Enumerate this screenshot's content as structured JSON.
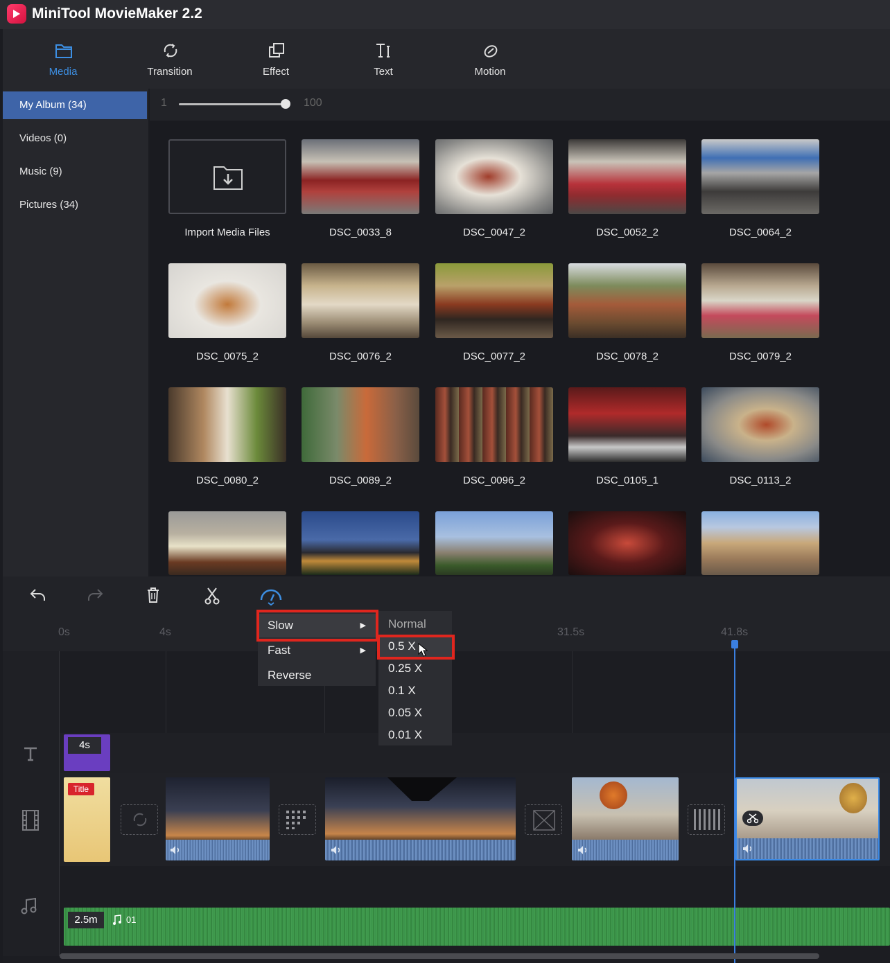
{
  "app": {
    "title": "MiniTool MovieMaker 2.2"
  },
  "toolbar": [
    {
      "label": "Media",
      "icon": "folder-icon",
      "active": true
    },
    {
      "label": "Transition",
      "icon": "transition-icon"
    },
    {
      "label": "Effect",
      "icon": "effect-icon"
    },
    {
      "label": "Text",
      "icon": "text-icon"
    },
    {
      "label": "Motion",
      "icon": "motion-icon"
    }
  ],
  "albums": [
    {
      "label": "My Album",
      "count": "(34)"
    },
    {
      "label": "Videos",
      "count": "(0)"
    },
    {
      "label": "Music",
      "count": "(9)"
    },
    {
      "label": "Pictures",
      "count": "(34)"
    }
  ],
  "zoom": {
    "min": "1",
    "max": "100",
    "value": 100
  },
  "media": [
    {
      "name": "Import Media Files"
    },
    {
      "name": "DSC_0033_8"
    },
    {
      "name": "DSC_0047_2"
    },
    {
      "name": "DSC_0052_2"
    },
    {
      "name": "DSC_0064_2"
    },
    {
      "name": "DSC_0075_2"
    },
    {
      "name": "DSC_0076_2"
    },
    {
      "name": "DSC_0077_2"
    },
    {
      "name": "DSC_0078_2"
    },
    {
      "name": "DSC_0079_2"
    },
    {
      "name": "DSC_0080_2"
    },
    {
      "name": "DSC_0089_2"
    },
    {
      "name": "DSC_0096_2"
    },
    {
      "name": "DSC_0105_1"
    },
    {
      "name": "DSC_0113_2"
    }
  ],
  "timeline": {
    "ticks": [
      "0s",
      "4s",
      "31.5s",
      "41.8s"
    ],
    "title_clip": {
      "duration": "4s",
      "badge": "Title"
    },
    "music_clip": {
      "duration": "2.5m",
      "name": "01"
    }
  },
  "speed_menu": {
    "items": [
      "Slow",
      "Fast",
      "Reverse"
    ],
    "submenu": [
      "Normal",
      "0.5 X",
      "0.25 X",
      "0.1 X",
      "0.05 X",
      "0.01 X"
    ],
    "highlighted": "Slow",
    "selected": "0.5 X"
  },
  "colors": {
    "accent": "#3d8fe3",
    "highlight": "#e0261e",
    "music": "#3f9a4c"
  }
}
